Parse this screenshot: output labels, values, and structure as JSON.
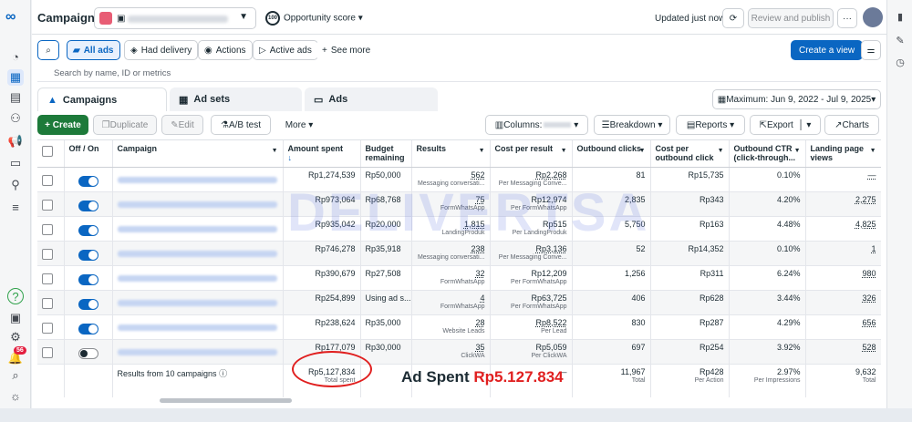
{
  "app": {
    "title": "Campaigns",
    "opportunity": "Opportunity score",
    "opportunity_value": "100",
    "updated": "Updated just now",
    "review_btn": "Review and publish",
    "more_btn": "···"
  },
  "filters": {
    "all_ads": "All ads",
    "had_delivery": "Had delivery",
    "actions": "Actions",
    "active_ads": "Active ads",
    "see_more": "See more",
    "create_view": "Create a view"
  },
  "search": {
    "placeholder": "Search by name, ID or metrics"
  },
  "tabs": {
    "campaigns": "Campaigns",
    "adsets": "Ad sets",
    "ads": "Ads",
    "date": "Maximum: Jun 9, 2022 - Jul 9, 2025"
  },
  "toolbar": {
    "create": "Create",
    "duplicate": "Duplicate",
    "edit": "Edit",
    "ab_test": "A/B test",
    "more": "More",
    "columns": "Columns:",
    "breakdown": "Breakdown",
    "reports": "Reports",
    "export": "Export",
    "charts": "Charts"
  },
  "columns": [
    "Off / On",
    "Campaign",
    "Amount spent",
    "Budget remaining",
    "Results",
    "Cost per result",
    "Outbound clicks",
    "Cost per outbound click",
    "Outbound CTR (click-through...",
    "Landing page views"
  ],
  "rows": [
    {
      "on": true,
      "spent": "Rp1,274,539",
      "budget": "Rp50,000",
      "results": "562",
      "results_sub": "Messaging conversati...",
      "cpr": "Rp2,268",
      "cpr_sub": "Per Messaging Conve...",
      "clicks": "81",
      "cpc": "Rp15,735",
      "ctr": "0.10%",
      "lpv": "—"
    },
    {
      "on": true,
      "spent": "Rp973,064",
      "budget": "Rp68,768",
      "results": "75",
      "results_sub": "FormWhatsApp",
      "cpr": "Rp12,974",
      "cpr_sub": "Per FormWhatsApp",
      "clicks": "2,835",
      "cpc": "Rp343",
      "ctr": "4.20%",
      "lpv": "2,275"
    },
    {
      "on": true,
      "spent": "Rp935,042",
      "budget": "Rp20,000",
      "results": "1,815",
      "results_sub": "LandingProduk",
      "cpr": "Rp515",
      "cpr_sub": "Per LandingProduk",
      "clicks": "5,750",
      "cpc": "Rp163",
      "ctr": "4.48%",
      "lpv": "4,825"
    },
    {
      "on": true,
      "spent": "Rp746,278",
      "budget": "Rp35,918",
      "results": "238",
      "results_sub": "Messaging conversati...",
      "cpr": "Rp3,136",
      "cpr_sub": "Per Messaging Conve...",
      "clicks": "52",
      "cpc": "Rp14,352",
      "ctr": "0.10%",
      "lpv": "1"
    },
    {
      "on": true,
      "spent": "Rp390,679",
      "budget": "Rp27,508",
      "results": "32",
      "results_sub": "FormWhatsApp",
      "cpr": "Rp12,209",
      "cpr_sub": "Per FormWhatsApp",
      "clicks": "1,256",
      "cpc": "Rp311",
      "ctr": "6.24%",
      "lpv": "980"
    },
    {
      "on": true,
      "spent": "Rp254,899",
      "budget": "Using ad s...",
      "results": "4",
      "results_sub": "FormWhatsApp",
      "cpr": "Rp63,725",
      "cpr_sub": "Per FormWhatsApp",
      "clicks": "406",
      "cpc": "Rp628",
      "ctr": "3.44%",
      "lpv": "326"
    },
    {
      "on": true,
      "spent": "Rp238,624",
      "budget": "Rp35,000",
      "results": "28",
      "results_sub": "Website Leads",
      "cpr": "Rp8,522",
      "cpr_sub": "Per Lead",
      "clicks": "830",
      "cpc": "Rp287",
      "ctr": "4.29%",
      "lpv": "656"
    },
    {
      "on": false,
      "spent": "Rp177,079",
      "budget": "Rp30,000",
      "results": "35",
      "results_sub": "ClickWA",
      "cpr": "Rp5,059",
      "cpr_sub": "Per ClickWA",
      "clicks": "697",
      "cpc": "Rp254",
      "ctr": "3.92%",
      "lpv": "528"
    }
  ],
  "totals": {
    "label": "Results from 10 campaigns",
    "spent": "Rp5,127,834",
    "spent_sub": "Total spent",
    "results": "—",
    "cpr": "—",
    "clicks": "11,967",
    "clicks_sub": "Total",
    "cpc": "Rp428",
    "cpc_sub": "Per Action",
    "ctr": "2.97%",
    "ctr_sub": "Per Impressions",
    "lpv": "9,632",
    "lpv_sub": "Total"
  },
  "annotation": {
    "prefix": "Ad Spent ",
    "value": "Rp5.127.834"
  },
  "watermark": "DELIVERTSA",
  "left_badge": "56",
  "colors": {
    "accent": "#0a66c2",
    "annotation_red": "#e01f1f"
  }
}
